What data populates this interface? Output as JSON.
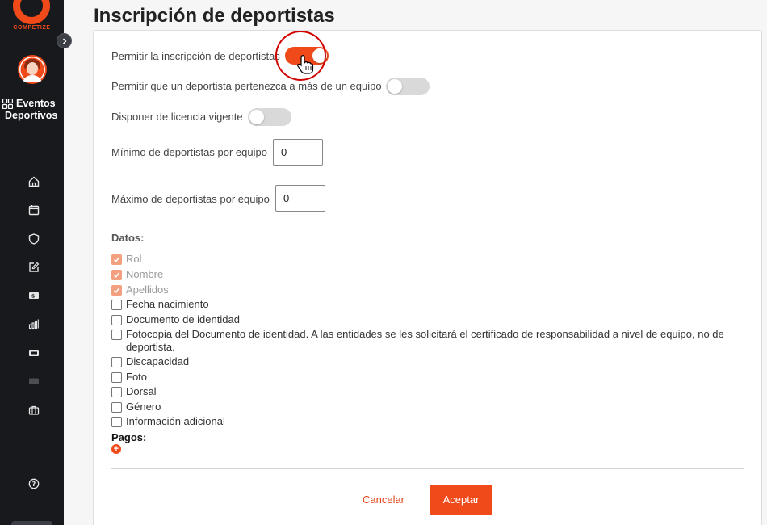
{
  "brand": {
    "name": "COMPETIZE",
    "accent": "#f04a1a"
  },
  "sidebar": {
    "title_line1": "Eventos",
    "title_line2": "Deportivos",
    "items": [
      {
        "icon": "home-icon"
      },
      {
        "icon": "calendar-icon"
      },
      {
        "icon": "shield-icon"
      },
      {
        "icon": "edit-icon"
      },
      {
        "icon": "payment-card-icon"
      },
      {
        "icon": "bar-chart-icon"
      },
      {
        "icon": "ticket-icon"
      },
      {
        "icon": "card-disabled-icon"
      },
      {
        "icon": "briefcase-icon"
      },
      {
        "icon": "help-icon"
      }
    ]
  },
  "page": {
    "title": "Inscripción de deportistas"
  },
  "form": {
    "allow_registration": {
      "label": "Permitir la inscripción de deportistas",
      "on": true
    },
    "multi_team": {
      "label": "Permitir que un deportista pertenezca a más de un equipo",
      "on": false
    },
    "license": {
      "label": "Disponer de licencia vigente",
      "on": false
    },
    "min_per_team": {
      "label": "Mínimo de deportistas por equipo",
      "value": "0"
    },
    "max_per_team": {
      "label": "Máximo de deportistas por equipo",
      "value": "0"
    },
    "datos_label": "Datos:",
    "datos": [
      {
        "label": "Rol",
        "checked": true,
        "disabled": true
      },
      {
        "label": "Nombre",
        "checked": true,
        "disabled": true
      },
      {
        "label": "Apellidos",
        "checked": true,
        "disabled": true
      },
      {
        "label": "Fecha nacimiento",
        "checked": false
      },
      {
        "label": "Documento de identidad",
        "checked": false
      },
      {
        "label": "Fotocopia del Documento de identidad. A las entidades se les solicitará el certificado de responsabilidad a nivel de equipo, no de deportista.",
        "checked": false
      },
      {
        "label": "Discapacidad",
        "checked": false
      },
      {
        "label": "Foto",
        "checked": false
      },
      {
        "label": "Dorsal",
        "checked": false
      },
      {
        "label": "Género",
        "checked": false
      },
      {
        "label": "Información adicional",
        "checked": false
      }
    ],
    "pagos_label": "Pagos:",
    "add_symbol": "+"
  },
  "actions": {
    "cancel": "Cancelar",
    "accept": "Aceptar"
  }
}
